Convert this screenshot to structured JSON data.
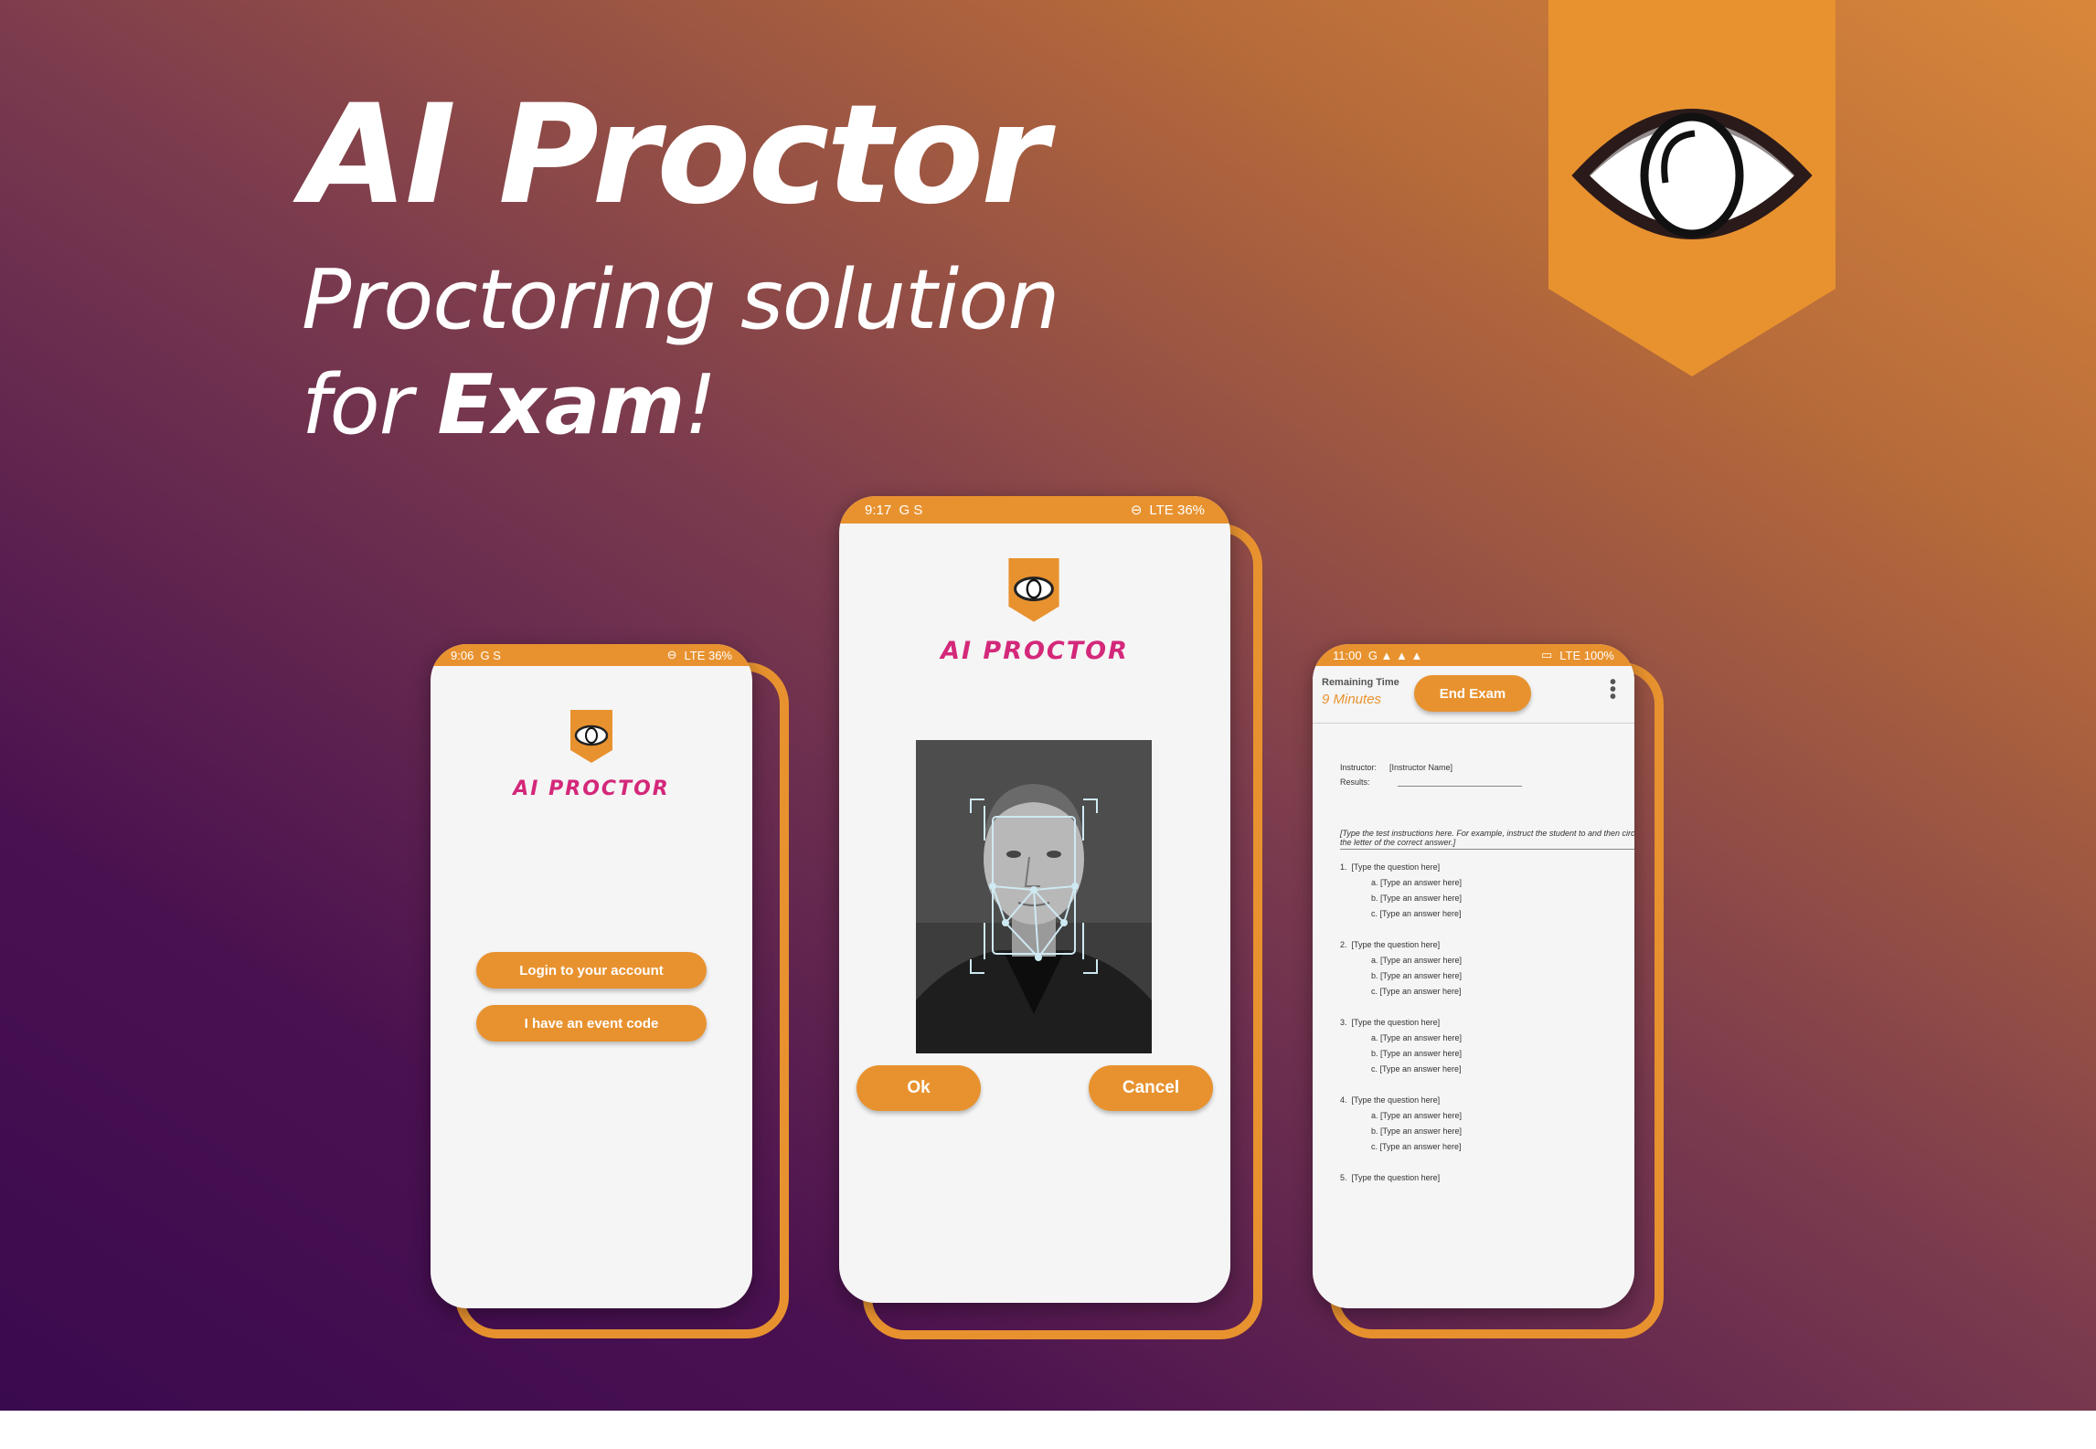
{
  "headline": {
    "title": "AI Proctor",
    "subtitle_line1": "Proctoring solution",
    "subtitle_line2_prefix": "for ",
    "subtitle_line2_bold": "Exam",
    "subtitle_line2_suffix": "!"
  },
  "banner": {
    "icon": "eye-icon",
    "color": "#e8922f"
  },
  "colors": {
    "accent": "#e8922f",
    "brand": "#d4287a"
  },
  "phone_login": {
    "status_time": "9:06",
    "status_icons": "G S",
    "status_right": "LTE 36%",
    "brand": "AI PROCTOR",
    "login_button": "Login to your account",
    "event_code_button": "I have an event code"
  },
  "phone_face": {
    "status_time": "9:17",
    "status_icons": "G S",
    "status_right": "LTE 36%",
    "brand": "AI PROCTOR",
    "ok_button": "Ok",
    "cancel_button": "Cancel"
  },
  "phone_exam": {
    "status_time": "11:00",
    "status_icons": "G ▲ ▲ ▲",
    "status_right": "LTE 100%",
    "remaining_label": "Remaining Time",
    "remaining_value": "9 Minutes",
    "end_button": "End Exam",
    "menu_icon": "more-vertical-icon",
    "instructor_label": "Instructor:",
    "instructor_value": "[Instructor Name]",
    "results_label": "Results:",
    "instructions": "[Type the test instructions here. For example, instruct the student to and then circle the letter of the correct answer.]",
    "questions": [
      {
        "num": "1.",
        "text": "[Type the question here]",
        "options": [
          "a.  [Type an answer here]",
          "b.  [Type an answer here]",
          "c.  [Type an answer here]"
        ]
      },
      {
        "num": "2.",
        "text": "[Type the question here]",
        "options": [
          "a.  [Type an answer here]",
          "b.  [Type an answer here]",
          "c.  [Type an answer here]"
        ]
      },
      {
        "num": "3.",
        "text": "[Type the question here]",
        "options": [
          "a.  [Type an answer here]",
          "b.  [Type an answer here]",
          "c.  [Type an answer here]"
        ]
      },
      {
        "num": "4.",
        "text": "[Type the question here]",
        "options": [
          "a.  [Type an answer here]",
          "b.  [Type an answer here]",
          "c.  [Type an answer here]"
        ]
      },
      {
        "num": "5.",
        "text": "[Type the question here]",
        "options": []
      }
    ]
  }
}
